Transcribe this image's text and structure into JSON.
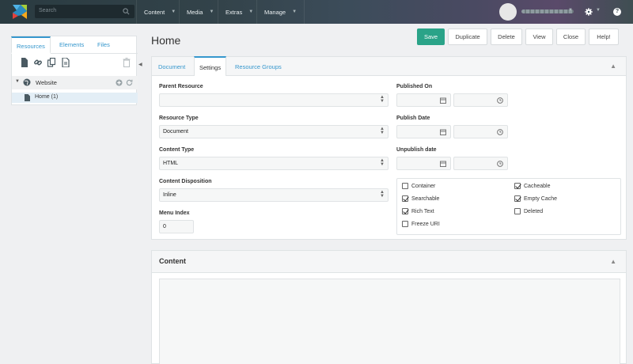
{
  "topbar": {
    "search_placeholder": "Search",
    "menus": [
      "Content",
      "Media",
      "Extras",
      "Manage"
    ],
    "icons": {
      "logo": "modx-logo",
      "search": "search-icon",
      "settings": "gear-icon",
      "help": "help-icon"
    }
  },
  "sidebar": {
    "tabs": [
      "Resources",
      "Elements",
      "Files"
    ],
    "active_tab": "Resources",
    "tree": {
      "root": "Website",
      "child": "Home (1)"
    }
  },
  "page": {
    "title": "Home",
    "buttons": [
      "Save",
      "Duplicate",
      "Delete",
      "View",
      "Close",
      "Help!"
    ]
  },
  "tabs": {
    "items": [
      "Document",
      "Settings",
      "Resource Groups"
    ],
    "active": "Settings"
  },
  "settings": {
    "parent_resource": {
      "label": "Parent Resource",
      "value": ""
    },
    "resource_type": {
      "label": "Resource Type",
      "value": "Document"
    },
    "content_type": {
      "label": "Content Type",
      "value": "HTML"
    },
    "content_disposition": {
      "label": "Content Disposition",
      "value": "Inline"
    },
    "menu_index": {
      "label": "Menu Index",
      "value": "0"
    },
    "published_on": {
      "label": "Published On"
    },
    "publish_date": {
      "label": "Publish Date"
    },
    "unpublish_date": {
      "label": "Unpublish date"
    },
    "checkboxes": [
      {
        "label": "Container",
        "checked": false
      },
      {
        "label": "Cacheable",
        "checked": true
      },
      {
        "label": "Searchable",
        "checked": true
      },
      {
        "label": "Empty Cache",
        "checked": true
      },
      {
        "label": "Rich Text",
        "checked": true
      },
      {
        "label": "Deleted",
        "checked": false
      },
      {
        "label": "Freeze URI",
        "checked": false
      }
    ]
  },
  "content": {
    "title": "Content"
  },
  "colors": {
    "accent": "#3697cd",
    "save": "#2aa388",
    "topbar": "#33434a"
  }
}
